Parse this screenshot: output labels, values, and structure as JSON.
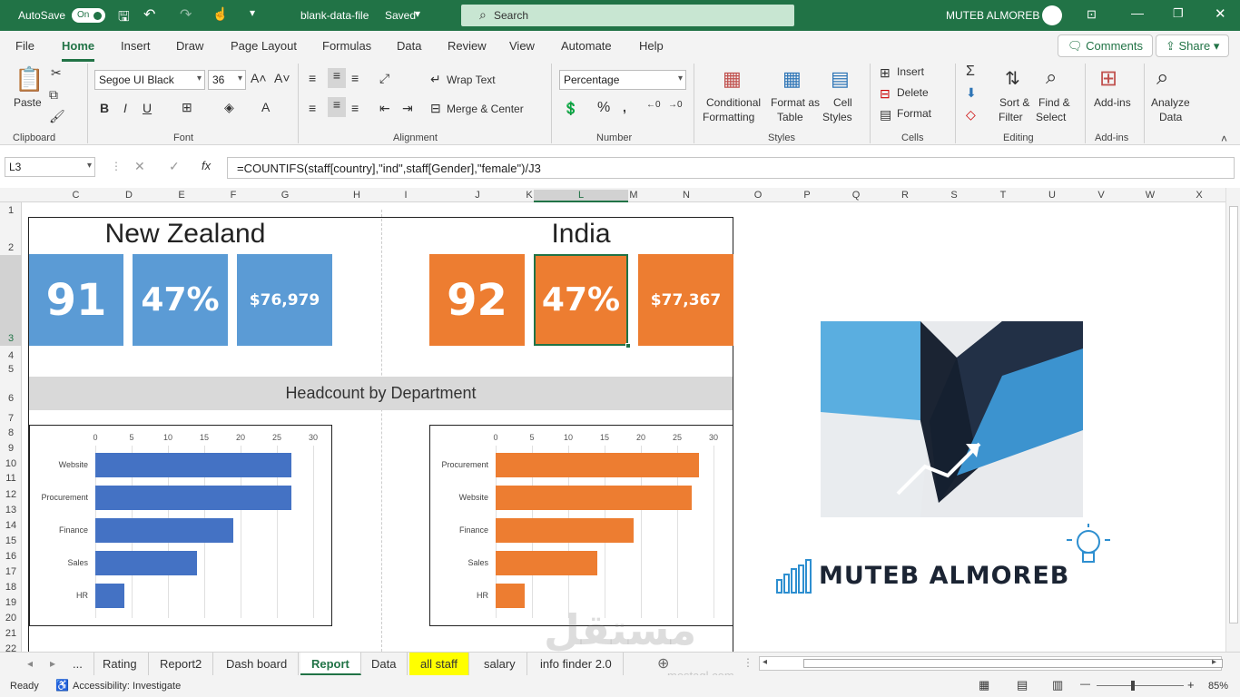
{
  "titlebar": {
    "autosave_label": "AutoSave",
    "autosave_state": "On",
    "file_name": "blank-data-file",
    "saved_label": "Saved",
    "search_placeholder": "Search",
    "user_name": "MUTEB ALMOREB"
  },
  "ribbon": {
    "tabs": [
      "File",
      "Home",
      "Insert",
      "Draw",
      "Page Layout",
      "Formulas",
      "Data",
      "Review",
      "View",
      "Automate",
      "Help"
    ],
    "active_tab": "Home",
    "comments_label": "Comments",
    "share_label": "Share",
    "clipboard": {
      "paste": "Paste",
      "group": "Clipboard"
    },
    "font": {
      "family": "Segoe UI Black",
      "size": "36",
      "group": "Font",
      "bold": "B",
      "italic": "I",
      "underline": "U"
    },
    "alignment": {
      "wrap": "Wrap Text",
      "merge": "Merge & Center",
      "group": "Alignment"
    },
    "number": {
      "format": "Percentage",
      "group": "Number"
    },
    "styles": {
      "conditional": "Conditional",
      "conditional2": "Formatting",
      "format_table": "Format as",
      "format_table2": "Table",
      "cell_styles": "Cell",
      "cell_styles2": "Styles",
      "group": "Styles"
    },
    "cells": {
      "insert": "Insert",
      "delete": "Delete",
      "format": "Format",
      "group": "Cells"
    },
    "editing": {
      "sort": "Sort &",
      "sort2": "Filter",
      "find": "Find &",
      "find2": "Select",
      "group": "Editing"
    },
    "addins": {
      "label": "Add-ins",
      "group": "Add-ins"
    },
    "analyze": {
      "label": "Analyze",
      "label2": "Data"
    }
  },
  "formula_bar": {
    "name_box": "L3",
    "formula": "=COUNTIFS(staff[country],\"ind\",staff[Gender],\"female\")/J3"
  },
  "columns": [
    "C",
    "D",
    "E",
    "F",
    "G",
    "H",
    "I",
    "J",
    "K",
    "L",
    "M",
    "N",
    "O",
    "P",
    "Q",
    "R",
    "S",
    "T",
    "U",
    "V",
    "W",
    "X"
  ],
  "rows": [
    "1",
    "2",
    "3",
    "4",
    "5",
    "6",
    "7",
    "8",
    "9",
    "10",
    "11",
    "12",
    "13",
    "14",
    "15",
    "16",
    "17",
    "18",
    "19",
    "20",
    "21",
    "22"
  ],
  "dashboard": {
    "nz_title": "New Zealand",
    "india_title": "India",
    "nz_headcount": "91",
    "nz_pct": "47%",
    "nz_salary": "$76,979",
    "in_headcount": "92",
    "in_pct": "47%",
    "in_salary": "$77,367",
    "section_title": "Headcount by Department",
    "logo_text": "MUTEB ALMOREB",
    "colors": {
      "nz": "#5b9bd5",
      "india": "#ed7d31",
      "nz_bar": "#4472c4",
      "india_bar": "#ed7d31"
    }
  },
  "chart_data": [
    {
      "type": "bar",
      "categories": [
        "Website",
        "Procurement",
        "Finance",
        "Sales",
        "HR"
      ],
      "values": [
        27,
        27,
        19,
        14,
        4
      ],
      "xlim": [
        0,
        30
      ],
      "ticks": [
        "0",
        "5",
        "10",
        "15",
        "20",
        "25",
        "30"
      ]
    },
    {
      "type": "bar",
      "categories": [
        "Procurement",
        "Website",
        "Finance",
        "Sales",
        "HR"
      ],
      "values": [
        28,
        27,
        19,
        14,
        4
      ],
      "xlim": [
        0,
        30
      ],
      "ticks": [
        "0",
        "5",
        "10",
        "15",
        "20",
        "25",
        "30"
      ]
    }
  ],
  "sheet_tabs": {
    "more": "...",
    "items": [
      "Rating",
      "Report2",
      "Dash board",
      "Report",
      "Data",
      "all staff",
      "salary",
      "info finder 2.0"
    ],
    "active": "Report"
  },
  "status": {
    "ready": "Ready",
    "accessibility": "Accessibility: Investigate",
    "zoom": "85%"
  },
  "watermark": {
    "arabic": "مستقل",
    "latin": "mostaql.com"
  }
}
